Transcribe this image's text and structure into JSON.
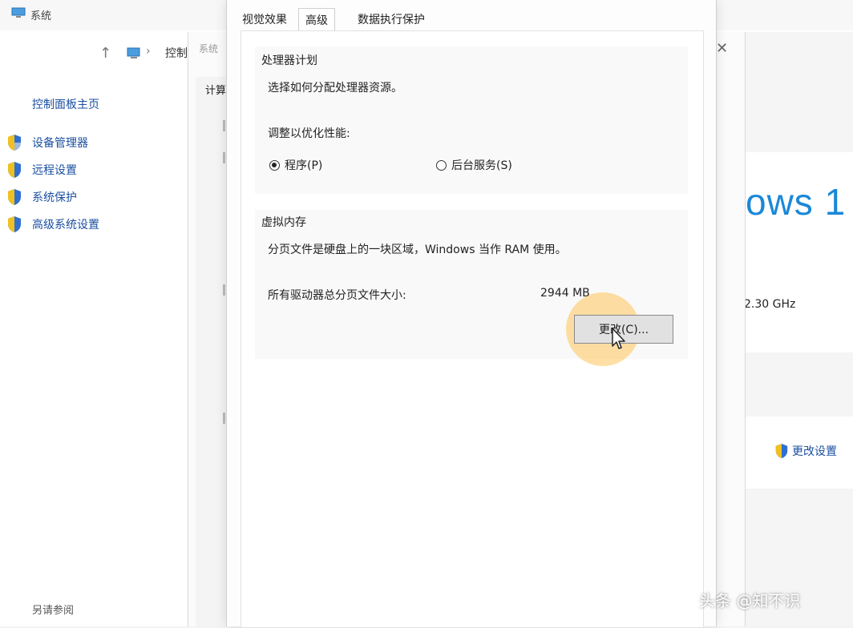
{
  "background_window": {
    "title": "系统",
    "breadcrumb": "控制",
    "control_panel_home": "控制面板主页",
    "side_links": [
      {
        "label": "设备管理器",
        "icon": "shield-icon"
      },
      {
        "label": "远程设置",
        "icon": "shield-icon"
      },
      {
        "label": "系统保护",
        "icon": "shield-icon"
      },
      {
        "label": "高级系统设置",
        "icon": "shield-icon"
      }
    ],
    "see_also": "另请参阅",
    "windows_brand": "ows 1",
    "cpu_speed": "2.30 GHz",
    "change_settings": "更改设置"
  },
  "middle_dialog": {
    "title": "系统",
    "tab_fragment": "计算"
  },
  "dialog": {
    "tabs": [
      {
        "label": "视觉效果",
        "active": false
      },
      {
        "label": "高级",
        "active": true
      },
      {
        "label": "数据执行保护",
        "active": false
      }
    ],
    "processor": {
      "title": "处理器计划",
      "description": "选择如何分配处理器资源。",
      "adjust_label": "调整以优化性能:",
      "options": [
        {
          "label": "程序(P)",
          "checked": true
        },
        {
          "label": "后台服务(S)",
          "checked": false
        }
      ]
    },
    "virtual_memory": {
      "title": "虚拟内存",
      "description": "分页文件是硬盘上的一块区域，Windows 当作 RAM 使用。",
      "total_label": "所有驱动器总分页文件大小:",
      "total_value": "2944 MB",
      "change_button": "更改(C)..."
    }
  },
  "watermark": "头条 @知不识",
  "colors": {
    "link_blue": "#1b4fa0",
    "windows_blue": "#1a88d8",
    "highlight": "#ffc45a"
  }
}
